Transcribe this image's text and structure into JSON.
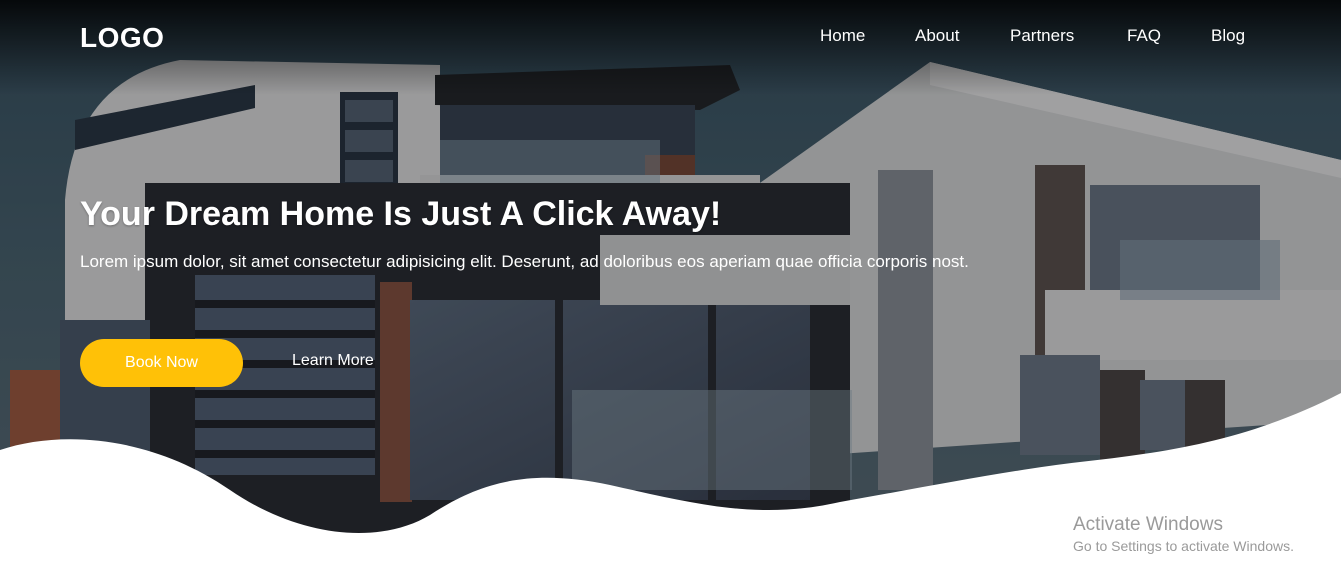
{
  "header": {
    "logo": "LOGO",
    "nav": [
      "Home",
      "About",
      "Partners",
      "FAQ",
      "Blog"
    ]
  },
  "hero": {
    "headline": "Your Dream Home Is Just A Click Away!",
    "lead": "Lorem ipsum dolor, sit amet consectetur adipisicing elit. Deserunt, ad doloribus eos aperiam quae officia corporis nost.",
    "book_button": "Book Now",
    "learn_link": "Learn More"
  },
  "watermark": {
    "title": "Activate Windows",
    "subtitle": "Go to Settings to activate Windows."
  },
  "colors": {
    "accent": "#ffc107",
    "text_light": "#ffffff",
    "watermark": "#9a9a9a"
  }
}
